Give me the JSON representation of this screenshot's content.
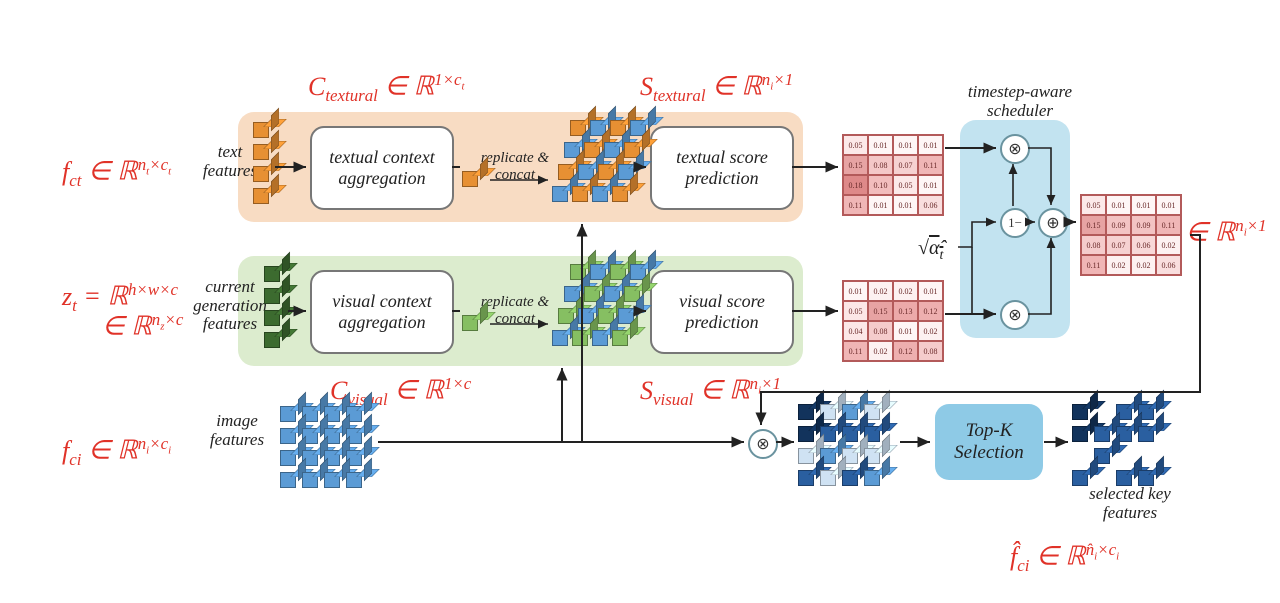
{
  "formulas": {
    "c_textural": "C₍textural₎ ∈ ℝ^(1×c_t)",
    "s_textural": "S₍textural₎ ∈ ℝ^(n_i×1)",
    "f_ct": "f_ct ∈ ℝ^(n_t×c_t)",
    "c_visual": "C₍visual₎ ∈ ℝ^(1×c)",
    "s_visual": "S₍visual₎ ∈ ℝ^(n_i×1)",
    "z_t_line1": "z_t = ℝ^(h×w×c)",
    "z_t_line2": "∈ ℝ^(n_z×c)",
    "f_ci": "f_ci ∈ ℝ^(n_i×c_i)",
    "s_final": "S ∈ ℝ^(n_i×1)",
    "f_ci_hat": "f̂_ci ∈ ℝ^(n̂_i×c_i)",
    "sqrt_alpha": "√(α̂_t)",
    "one_minus": "1−"
  },
  "labels": {
    "text_features": "text features",
    "current_gen_features_l1": "current",
    "current_gen_features_l2": "generation",
    "current_gen_features_l3": "features",
    "image_features": "image features",
    "replicate_concat_l1": "replicate &",
    "replicate_concat_l2": "concat",
    "timestep_scheduler_l1": "timestep-aware",
    "timestep_scheduler_l2": "scheduler",
    "selected_l1": "selected key",
    "selected_l2": "features"
  },
  "boxes": {
    "textual_aggregation": "textual context aggregation",
    "textual_score": "textual score prediction",
    "visual_aggregation": "visual context aggregation",
    "visual_score": "visual score prediction",
    "topk": "Top-K Selection"
  },
  "heat_textual": [
    "0.05",
    "0.01",
    "0.01",
    "0.01",
    "0.15",
    "0.08",
    "0.07",
    "0.11",
    "0.18",
    "0.10",
    "0.05",
    "0.01",
    "0.11",
    "0.01",
    "0.01",
    "0.06"
  ],
  "heat_textual_shade": [
    "#fce9e9",
    "#fef6f6",
    "#fef6f6",
    "#fef6f6",
    "#e7a3a3",
    "#f4c8c8",
    "#f6d1d1",
    "#f0b6b6",
    "#de8989",
    "#f2bdbd",
    "#fce9e9",
    "#fef6f6",
    "#f0b6b6",
    "#fef6f6",
    "#fef6f6",
    "#f9dede"
  ],
  "heat_visual": [
    "0.01",
    "0.02",
    "0.02",
    "0.01",
    "0.05",
    "0.15",
    "0.13",
    "0.12",
    "0.04",
    "0.08",
    "0.01",
    "0.02",
    "0.11",
    "0.02",
    "0.12",
    "0.08"
  ],
  "heat_visual_shade": [
    "#fef6f6",
    "#fdf1f1",
    "#fdf1f1",
    "#fef6f6",
    "#fce6e6",
    "#e7a3a3",
    "#eca9a9",
    "#eeafaf",
    "#fce7e7",
    "#f5cccc",
    "#fef6f6",
    "#fdf1f1",
    "#f0b5b5",
    "#fdf1f1",
    "#eeafaf",
    "#f5cccc"
  ],
  "heat_final": [
    "0.05",
    "0.01",
    "0.01",
    "0.01",
    "0.15",
    "0.09",
    "0.09",
    "0.11",
    "0.08",
    "0.07",
    "0.06",
    "0.02",
    "0.11",
    "0.02",
    "0.02",
    "0.06"
  ],
  "heat_final_shade": [
    "#fce9e9",
    "#fef6f6",
    "#fef6f6",
    "#fef6f6",
    "#e7a3a3",
    "#f3c3c3",
    "#f3c3c3",
    "#f0b6b6",
    "#f5cccc",
    "#f6d1d1",
    "#f8d8d8",
    "#fdf1f1",
    "#f0b5b5",
    "#fdf1f1",
    "#fdf1f1",
    "#f9dede"
  ]
}
